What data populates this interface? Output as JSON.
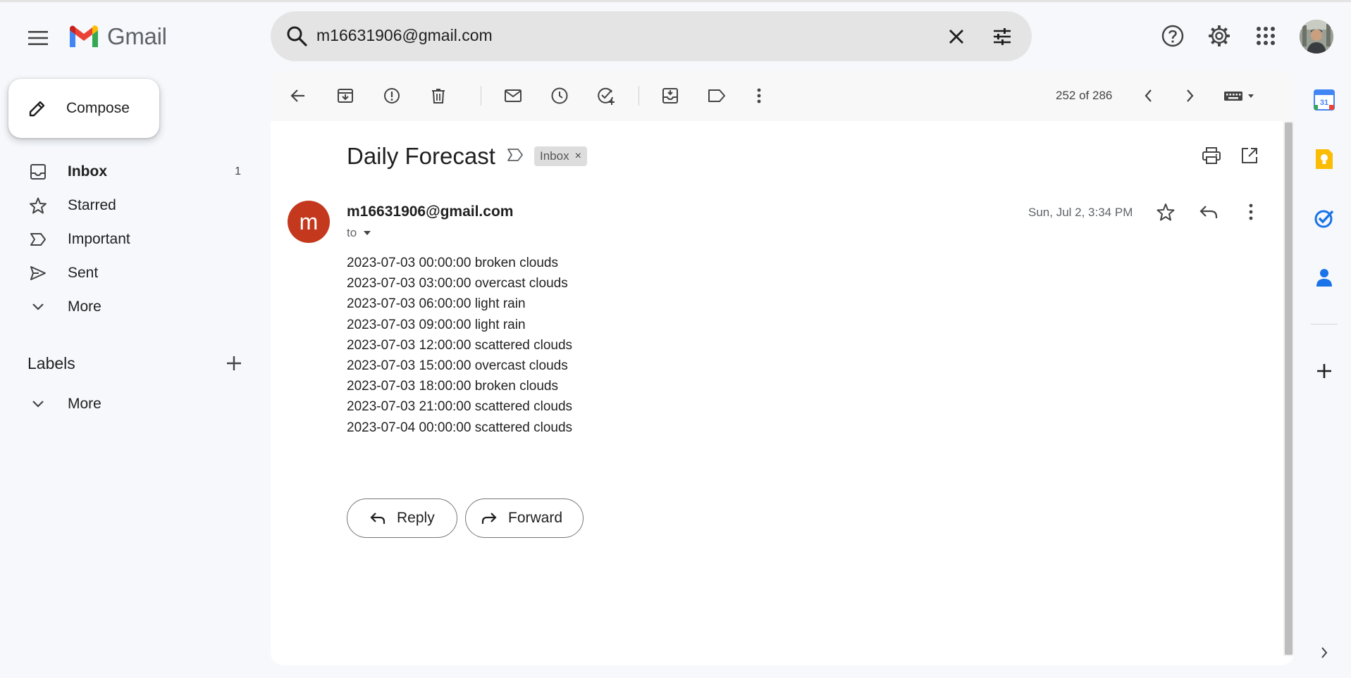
{
  "header": {
    "app_name": "Gmail",
    "search_value": "m16631906@gmail.com"
  },
  "nav": {
    "compose_label": "Compose",
    "items": [
      {
        "label": "Inbox",
        "count": "1"
      },
      {
        "label": "Starred"
      },
      {
        "label": "Important"
      },
      {
        "label": "Sent"
      },
      {
        "label": "More"
      }
    ],
    "labels_title": "Labels",
    "labels_more": "More"
  },
  "toolbar": {
    "page_count": "252 of 286"
  },
  "email": {
    "subject": "Daily Forecast",
    "label_chip": "Inbox",
    "chip_close": "×",
    "sender_initial": "m",
    "sender": "m16631906@gmail.com",
    "to": "to",
    "date": "Sun, Jul 2, 3:34 PM",
    "body": [
      "2023-07-03 00:00:00 broken clouds",
      "2023-07-03 03:00:00 overcast clouds",
      "2023-07-03 06:00:00 light rain",
      "2023-07-03 09:00:00 light rain",
      "2023-07-03 12:00:00 scattered clouds",
      "2023-07-03 15:00:00 overcast clouds",
      "2023-07-03 18:00:00 broken clouds",
      "2023-07-03 21:00:00 scattered clouds",
      "2023-07-04 00:00:00 scattered clouds"
    ],
    "reply_label": "Reply",
    "forward_label": "Forward"
  },
  "side_panel": {
    "calendar_day": "31"
  },
  "colors": {
    "background": "#f6f8fc",
    "avatar": "#c4391d",
    "search_bg": "#e4e4e4"
  },
  "icons": [
    "menu-icon",
    "search-icon",
    "close-icon",
    "tune-icon",
    "help-icon",
    "gear-icon",
    "apps-icon",
    "pencil-icon",
    "inbox-icon",
    "star-icon",
    "important-icon",
    "send-icon",
    "chevron-down-icon",
    "plus-icon",
    "back-arrow-icon",
    "archive-icon",
    "report-spam-icon",
    "delete-icon",
    "mark-unread-icon",
    "snooze-icon",
    "add-task-icon",
    "move-to-icon",
    "label-icon",
    "more-vert-icon",
    "chevron-left-icon",
    "chevron-right-icon",
    "keyboard-icon",
    "print-icon",
    "open-new-window-icon",
    "reply-icon",
    "forward-icon",
    "calendar-icon",
    "keep-icon",
    "tasks-icon",
    "contacts-icon",
    "expand-icon"
  ]
}
